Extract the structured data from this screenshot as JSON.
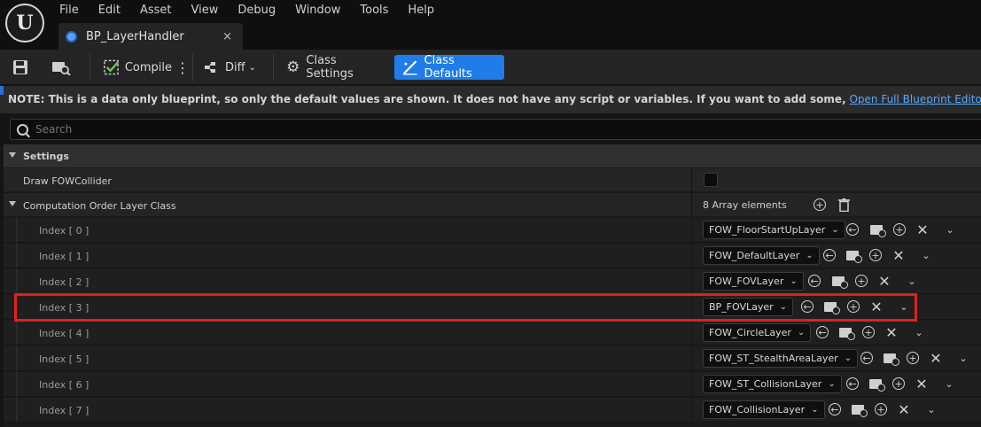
{
  "app": {
    "logo_text": "U"
  },
  "menu": [
    "File",
    "Edit",
    "Asset",
    "View",
    "Debug",
    "Window",
    "Tools",
    "Help"
  ],
  "tab": {
    "title": "BP_LayerHandler",
    "close": "×"
  },
  "toolbar": {
    "compile_label": "Compile",
    "diff_label": "Diff",
    "class_settings_label": "Class Settings",
    "class_defaults_label": "Class Defaults",
    "accent_color": "#1f7ce8"
  },
  "note": {
    "bold_text": "NOTE: This is a data only blueprint, so only the default values are shown.  It does not have any script or variables.  If you want to add some,",
    "link_text": "Open Full Blueprint Editor"
  },
  "search": {
    "placeholder": "Search"
  },
  "details": {
    "category": "Settings",
    "draw_fow_label": "Draw FOWCollider",
    "array_label": "Computation Order Layer Class",
    "array_count": "8 Array elements",
    "elements": [
      {
        "index": "Index [ 0 ]",
        "value": "FOW_FloorStartUpLayer"
      },
      {
        "index": "Index [ 1 ]",
        "value": "FOW_DefaultLayer"
      },
      {
        "index": "Index [ 2 ]",
        "value": "FOW_FOVLayer"
      },
      {
        "index": "Index [ 3 ]",
        "value": "BP_FOVLayer"
      },
      {
        "index": "Index [ 4 ]",
        "value": "FOW_CircleLayer"
      },
      {
        "index": "Index [ 5 ]",
        "value": "FOW_ST_StealthAreaLayer"
      },
      {
        "index": "Index [ 6 ]",
        "value": "FOW_ST_CollisionLayer"
      },
      {
        "index": "Index [ 7 ]",
        "value": "FOW_CollisionLayer"
      }
    ],
    "highlight_color": "#e02020"
  }
}
